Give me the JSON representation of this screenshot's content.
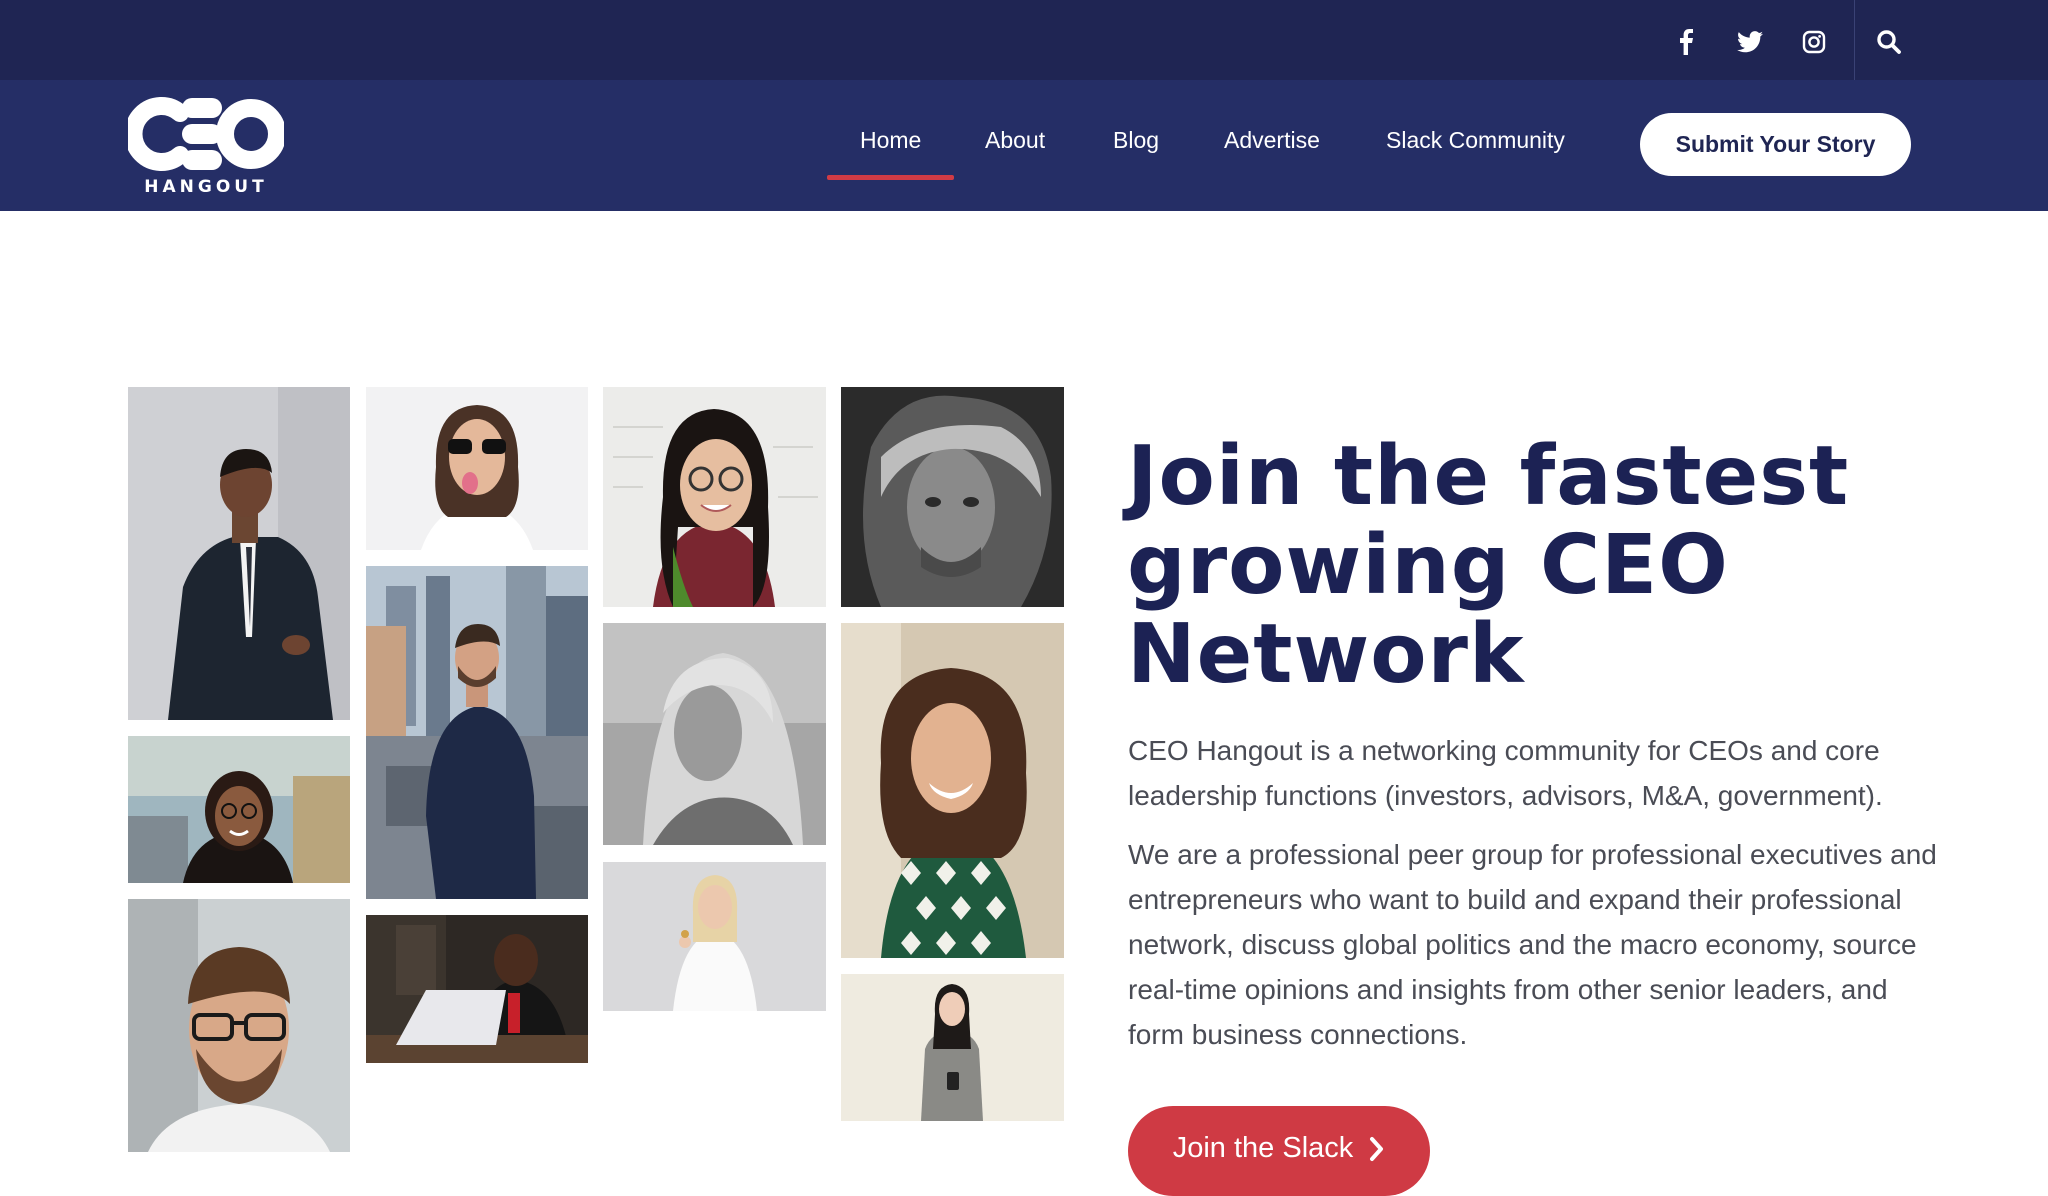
{
  "social": {
    "items": [
      {
        "name": "facebook",
        "icon": "facebook-icon"
      },
      {
        "name": "twitter",
        "icon": "twitter-icon"
      },
      {
        "name": "instagram",
        "icon": "instagram-icon"
      }
    ],
    "search_icon": "search-icon"
  },
  "brand": {
    "logo_main": "CEO",
    "logo_sub": "HANGOUT"
  },
  "nav": {
    "items": [
      {
        "label": "Home",
        "active": true
      },
      {
        "label": "About"
      },
      {
        "label": "Blog"
      },
      {
        "label": "Advertise"
      },
      {
        "label": "Slack Community"
      }
    ],
    "cta_label": "Submit Your Story"
  },
  "hero": {
    "title": "Join the fastest growing CEO Network",
    "paragraph_1": "CEO Hangout is a networking community for CEOs and core leadership functions (investors, advisors, M&A, government).",
    "paragraph_2": "We are a professional peer group for professional executives and entrepreneurs who want to build and expand their professional network, discuss global politics and the macro economy, source real-time opinions and insights from other senior leaders, and form business connections.",
    "cta_label": "Join the Slack",
    "cta_icon": "chevron-right-icon"
  },
  "colors": {
    "topbar": "#1f2553",
    "navbar": "#252e66",
    "heading": "#1c2254",
    "accent": "#cf3a44",
    "body_text": "#4a4c55"
  }
}
